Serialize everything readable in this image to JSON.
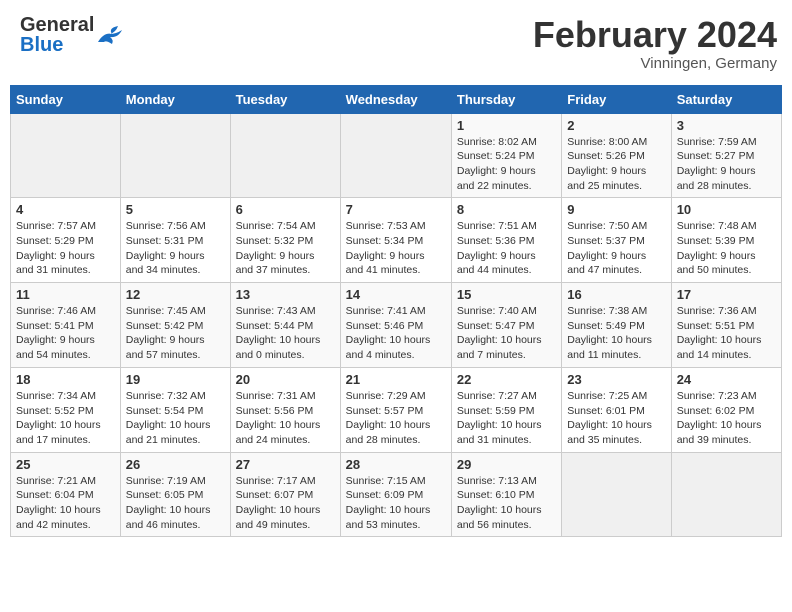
{
  "header": {
    "logo_general": "General",
    "logo_blue": "Blue",
    "month_title": "February 2024",
    "location": "Vinningen, Germany"
  },
  "weekdays": [
    "Sunday",
    "Monday",
    "Tuesday",
    "Wednesday",
    "Thursday",
    "Friday",
    "Saturday"
  ],
  "weeks": [
    [
      {
        "day": "",
        "info": ""
      },
      {
        "day": "",
        "info": ""
      },
      {
        "day": "",
        "info": ""
      },
      {
        "day": "",
        "info": ""
      },
      {
        "day": "1",
        "info": "Sunrise: 8:02 AM\nSunset: 5:24 PM\nDaylight: 9 hours\nand 22 minutes."
      },
      {
        "day": "2",
        "info": "Sunrise: 8:00 AM\nSunset: 5:26 PM\nDaylight: 9 hours\nand 25 minutes."
      },
      {
        "day": "3",
        "info": "Sunrise: 7:59 AM\nSunset: 5:27 PM\nDaylight: 9 hours\nand 28 minutes."
      }
    ],
    [
      {
        "day": "4",
        "info": "Sunrise: 7:57 AM\nSunset: 5:29 PM\nDaylight: 9 hours\nand 31 minutes."
      },
      {
        "day": "5",
        "info": "Sunrise: 7:56 AM\nSunset: 5:31 PM\nDaylight: 9 hours\nand 34 minutes."
      },
      {
        "day": "6",
        "info": "Sunrise: 7:54 AM\nSunset: 5:32 PM\nDaylight: 9 hours\nand 37 minutes."
      },
      {
        "day": "7",
        "info": "Sunrise: 7:53 AM\nSunset: 5:34 PM\nDaylight: 9 hours\nand 41 minutes."
      },
      {
        "day": "8",
        "info": "Sunrise: 7:51 AM\nSunset: 5:36 PM\nDaylight: 9 hours\nand 44 minutes."
      },
      {
        "day": "9",
        "info": "Sunrise: 7:50 AM\nSunset: 5:37 PM\nDaylight: 9 hours\nand 47 minutes."
      },
      {
        "day": "10",
        "info": "Sunrise: 7:48 AM\nSunset: 5:39 PM\nDaylight: 9 hours\nand 50 minutes."
      }
    ],
    [
      {
        "day": "11",
        "info": "Sunrise: 7:46 AM\nSunset: 5:41 PM\nDaylight: 9 hours\nand 54 minutes."
      },
      {
        "day": "12",
        "info": "Sunrise: 7:45 AM\nSunset: 5:42 PM\nDaylight: 9 hours\nand 57 minutes."
      },
      {
        "day": "13",
        "info": "Sunrise: 7:43 AM\nSunset: 5:44 PM\nDaylight: 10 hours\nand 0 minutes."
      },
      {
        "day": "14",
        "info": "Sunrise: 7:41 AM\nSunset: 5:46 PM\nDaylight: 10 hours\nand 4 minutes."
      },
      {
        "day": "15",
        "info": "Sunrise: 7:40 AM\nSunset: 5:47 PM\nDaylight: 10 hours\nand 7 minutes."
      },
      {
        "day": "16",
        "info": "Sunrise: 7:38 AM\nSunset: 5:49 PM\nDaylight: 10 hours\nand 11 minutes."
      },
      {
        "day": "17",
        "info": "Sunrise: 7:36 AM\nSunset: 5:51 PM\nDaylight: 10 hours\nand 14 minutes."
      }
    ],
    [
      {
        "day": "18",
        "info": "Sunrise: 7:34 AM\nSunset: 5:52 PM\nDaylight: 10 hours\nand 17 minutes."
      },
      {
        "day": "19",
        "info": "Sunrise: 7:32 AM\nSunset: 5:54 PM\nDaylight: 10 hours\nand 21 minutes."
      },
      {
        "day": "20",
        "info": "Sunrise: 7:31 AM\nSunset: 5:56 PM\nDaylight: 10 hours\nand 24 minutes."
      },
      {
        "day": "21",
        "info": "Sunrise: 7:29 AM\nSunset: 5:57 PM\nDaylight: 10 hours\nand 28 minutes."
      },
      {
        "day": "22",
        "info": "Sunrise: 7:27 AM\nSunset: 5:59 PM\nDaylight: 10 hours\nand 31 minutes."
      },
      {
        "day": "23",
        "info": "Sunrise: 7:25 AM\nSunset: 6:01 PM\nDaylight: 10 hours\nand 35 minutes."
      },
      {
        "day": "24",
        "info": "Sunrise: 7:23 AM\nSunset: 6:02 PM\nDaylight: 10 hours\nand 39 minutes."
      }
    ],
    [
      {
        "day": "25",
        "info": "Sunrise: 7:21 AM\nSunset: 6:04 PM\nDaylight: 10 hours\nand 42 minutes."
      },
      {
        "day": "26",
        "info": "Sunrise: 7:19 AM\nSunset: 6:05 PM\nDaylight: 10 hours\nand 46 minutes."
      },
      {
        "day": "27",
        "info": "Sunrise: 7:17 AM\nSunset: 6:07 PM\nDaylight: 10 hours\nand 49 minutes."
      },
      {
        "day": "28",
        "info": "Sunrise: 7:15 AM\nSunset: 6:09 PM\nDaylight: 10 hours\nand 53 minutes."
      },
      {
        "day": "29",
        "info": "Sunrise: 7:13 AM\nSunset: 6:10 PM\nDaylight: 10 hours\nand 56 minutes."
      },
      {
        "day": "",
        "info": ""
      },
      {
        "day": "",
        "info": ""
      }
    ]
  ]
}
